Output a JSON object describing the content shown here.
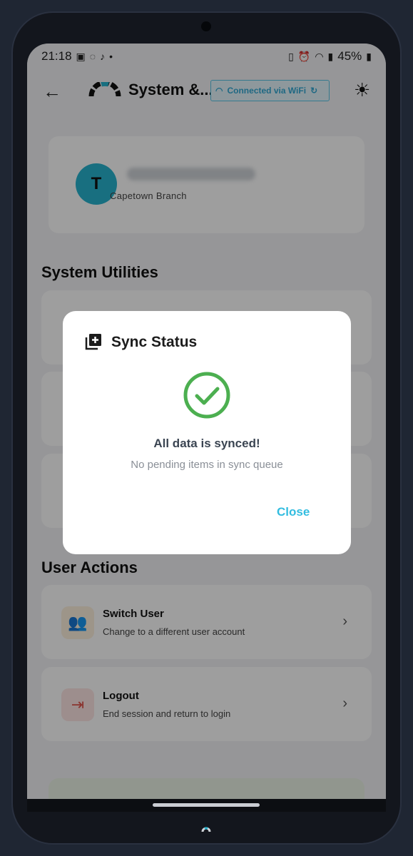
{
  "status_bar": {
    "time": "21:18",
    "battery": "45%"
  },
  "app_bar": {
    "title": "System &...",
    "connection_chip": "Connected via WiFi"
  },
  "profile": {
    "avatar_initial": "T",
    "branch": "Capetown Branch"
  },
  "sections": {
    "system_utilities": "System Utilities",
    "user_actions": "User Actions"
  },
  "user_actions": [
    {
      "title": "Switch User",
      "subtitle": "Change to a different user account",
      "icon": "people-icon",
      "color": "#e6a23c"
    },
    {
      "title": "Logout",
      "subtitle": "End session and return to login",
      "icon": "logout-icon",
      "color": "#e0544c"
    }
  ],
  "dialog": {
    "title": "Sync Status",
    "message": "All data is synced!",
    "submessage": "No pending items in sync queue",
    "close_label": "Close"
  },
  "colors": {
    "accent": "#33bde0",
    "success": "#4caf50",
    "avatar": "#27b4cf"
  }
}
